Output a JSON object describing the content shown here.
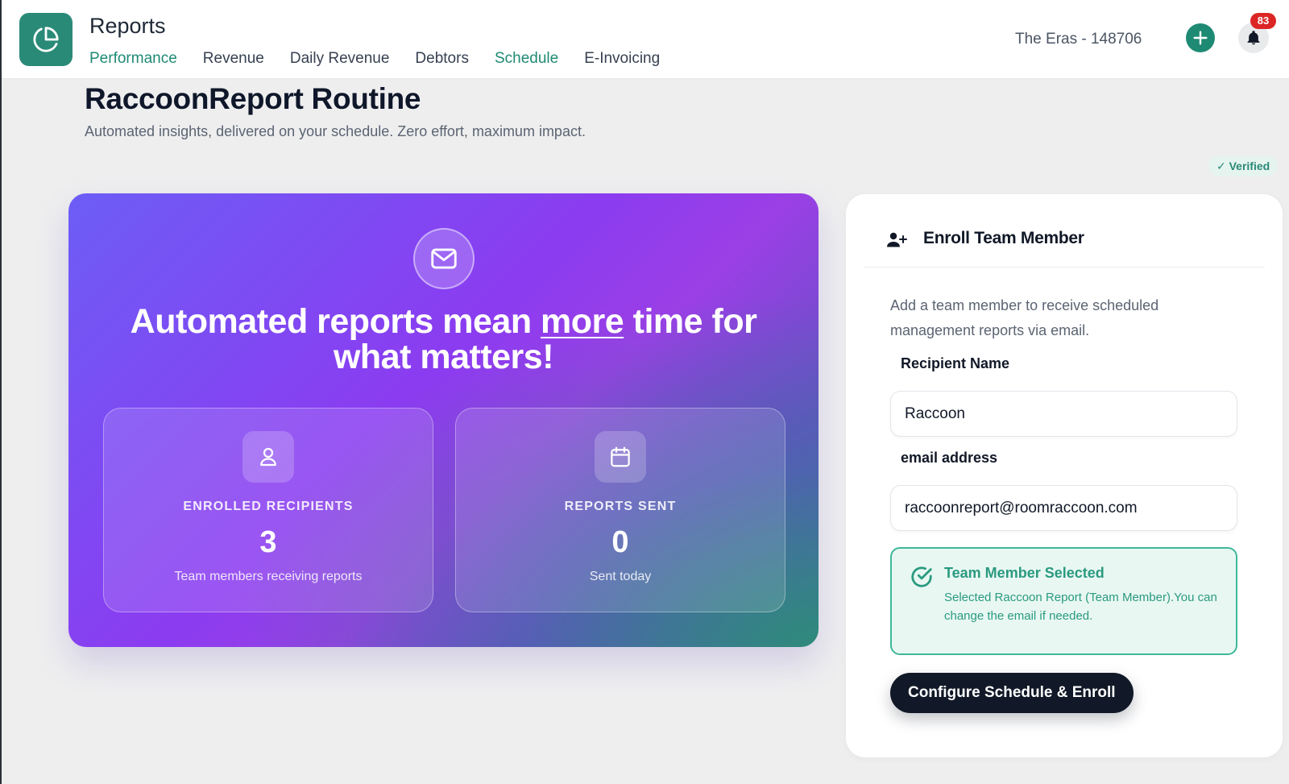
{
  "header": {
    "app_title": "Reports",
    "logo_icon": "pie-chart-icon",
    "nav": [
      {
        "label": "Performance",
        "active": true
      },
      {
        "label": "Revenue",
        "active": false
      },
      {
        "label": "Daily Revenue",
        "active": false
      },
      {
        "label": "Debtors",
        "active": false
      },
      {
        "label": "Schedule",
        "active": true
      },
      {
        "label": "E-Invoicing",
        "active": false
      }
    ],
    "property_name": "The Eras - 148706",
    "notification_count": "83"
  },
  "page": {
    "title": "RaccoonReport Routine",
    "subtitle": "Automated insights, delivered on your schedule. Zero effort, maximum impact.",
    "verified_label": "✓ Verified"
  },
  "hero": {
    "headline_part1": "Automated reports mean ",
    "headline_underlined": "more",
    "headline_part2": " time for what matters!",
    "stats": [
      {
        "icon": "user-icon",
        "label": "ENROLLED RECIPIENTS",
        "value": "3",
        "caption": "Team members receiving reports"
      },
      {
        "icon": "calendar-icon",
        "label": "REPORTS SENT",
        "value": "0",
        "caption": "Sent today"
      }
    ]
  },
  "enroll": {
    "title": "Enroll Team Member",
    "description": "Add a team member to receive scheduled management reports via email.",
    "name_label": "Recipient Name",
    "name_value": "Raccoon",
    "email_label": "email address",
    "email_value": "raccoonreport@roomraccoon.com",
    "selected_title": "Team Member Selected",
    "selected_text": "Selected Raccoon Report (Team Member).You can change the email if needed.",
    "submit_label": "Configure Schedule & Enroll"
  },
  "colors": {
    "brand": "#1f8a74",
    "badge": "#dc2626",
    "button_dark": "#111827",
    "success_bg": "#e8f7f2"
  }
}
